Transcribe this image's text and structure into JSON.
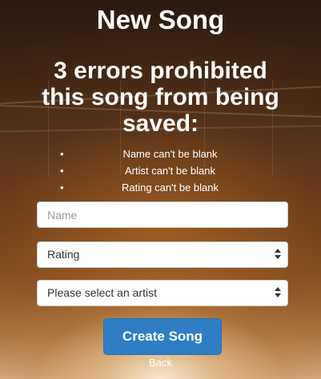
{
  "page": {
    "title": "New Song"
  },
  "errors": {
    "heading": "3 errors prohibited this song from being saved:",
    "items": [
      "Name can't be blank",
      "Artist can't be blank",
      "Rating can't be blank"
    ]
  },
  "form": {
    "name_placeholder": "Name",
    "rating_selected": "Rating",
    "artist_selected": "Please select an artist",
    "submit_label": "Create Song"
  },
  "nav": {
    "back_label": "Back"
  },
  "colors": {
    "button_primary": "#2f7ec4",
    "text": "#ffffff"
  }
}
